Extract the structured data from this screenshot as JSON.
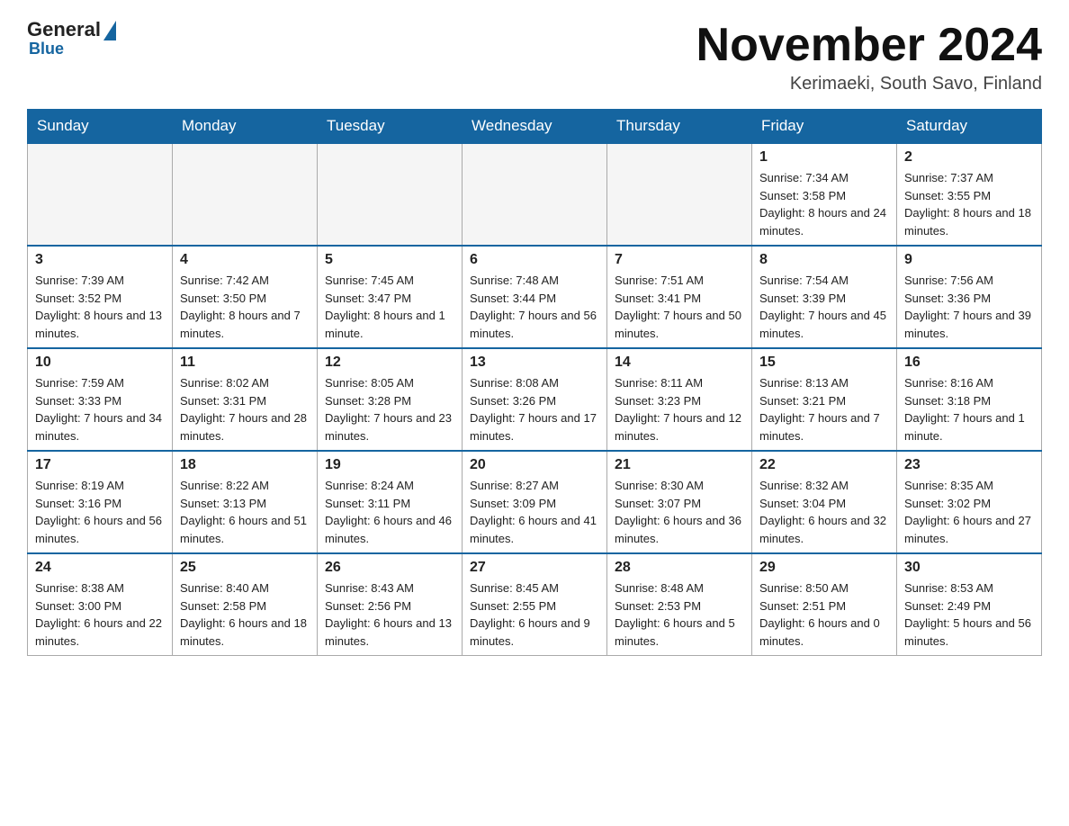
{
  "header": {
    "logo_general": "General",
    "logo_blue": "Blue",
    "month_title": "November 2024",
    "location": "Kerimaeki, South Savo, Finland"
  },
  "days_of_week": [
    "Sunday",
    "Monday",
    "Tuesday",
    "Wednesday",
    "Thursday",
    "Friday",
    "Saturday"
  ],
  "weeks": [
    [
      {
        "day": "",
        "info": ""
      },
      {
        "day": "",
        "info": ""
      },
      {
        "day": "",
        "info": ""
      },
      {
        "day": "",
        "info": ""
      },
      {
        "day": "",
        "info": ""
      },
      {
        "day": "1",
        "info": "Sunrise: 7:34 AM\nSunset: 3:58 PM\nDaylight: 8 hours and 24 minutes."
      },
      {
        "day": "2",
        "info": "Sunrise: 7:37 AM\nSunset: 3:55 PM\nDaylight: 8 hours and 18 minutes."
      }
    ],
    [
      {
        "day": "3",
        "info": "Sunrise: 7:39 AM\nSunset: 3:52 PM\nDaylight: 8 hours and 13 minutes."
      },
      {
        "day": "4",
        "info": "Sunrise: 7:42 AM\nSunset: 3:50 PM\nDaylight: 8 hours and 7 minutes."
      },
      {
        "day": "5",
        "info": "Sunrise: 7:45 AM\nSunset: 3:47 PM\nDaylight: 8 hours and 1 minute."
      },
      {
        "day": "6",
        "info": "Sunrise: 7:48 AM\nSunset: 3:44 PM\nDaylight: 7 hours and 56 minutes."
      },
      {
        "day": "7",
        "info": "Sunrise: 7:51 AM\nSunset: 3:41 PM\nDaylight: 7 hours and 50 minutes."
      },
      {
        "day": "8",
        "info": "Sunrise: 7:54 AM\nSunset: 3:39 PM\nDaylight: 7 hours and 45 minutes."
      },
      {
        "day": "9",
        "info": "Sunrise: 7:56 AM\nSunset: 3:36 PM\nDaylight: 7 hours and 39 minutes."
      }
    ],
    [
      {
        "day": "10",
        "info": "Sunrise: 7:59 AM\nSunset: 3:33 PM\nDaylight: 7 hours and 34 minutes."
      },
      {
        "day": "11",
        "info": "Sunrise: 8:02 AM\nSunset: 3:31 PM\nDaylight: 7 hours and 28 minutes."
      },
      {
        "day": "12",
        "info": "Sunrise: 8:05 AM\nSunset: 3:28 PM\nDaylight: 7 hours and 23 minutes."
      },
      {
        "day": "13",
        "info": "Sunrise: 8:08 AM\nSunset: 3:26 PM\nDaylight: 7 hours and 17 minutes."
      },
      {
        "day": "14",
        "info": "Sunrise: 8:11 AM\nSunset: 3:23 PM\nDaylight: 7 hours and 12 minutes."
      },
      {
        "day": "15",
        "info": "Sunrise: 8:13 AM\nSunset: 3:21 PM\nDaylight: 7 hours and 7 minutes."
      },
      {
        "day": "16",
        "info": "Sunrise: 8:16 AM\nSunset: 3:18 PM\nDaylight: 7 hours and 1 minute."
      }
    ],
    [
      {
        "day": "17",
        "info": "Sunrise: 8:19 AM\nSunset: 3:16 PM\nDaylight: 6 hours and 56 minutes."
      },
      {
        "day": "18",
        "info": "Sunrise: 8:22 AM\nSunset: 3:13 PM\nDaylight: 6 hours and 51 minutes."
      },
      {
        "day": "19",
        "info": "Sunrise: 8:24 AM\nSunset: 3:11 PM\nDaylight: 6 hours and 46 minutes."
      },
      {
        "day": "20",
        "info": "Sunrise: 8:27 AM\nSunset: 3:09 PM\nDaylight: 6 hours and 41 minutes."
      },
      {
        "day": "21",
        "info": "Sunrise: 8:30 AM\nSunset: 3:07 PM\nDaylight: 6 hours and 36 minutes."
      },
      {
        "day": "22",
        "info": "Sunrise: 8:32 AM\nSunset: 3:04 PM\nDaylight: 6 hours and 32 minutes."
      },
      {
        "day": "23",
        "info": "Sunrise: 8:35 AM\nSunset: 3:02 PM\nDaylight: 6 hours and 27 minutes."
      }
    ],
    [
      {
        "day": "24",
        "info": "Sunrise: 8:38 AM\nSunset: 3:00 PM\nDaylight: 6 hours and 22 minutes."
      },
      {
        "day": "25",
        "info": "Sunrise: 8:40 AM\nSunset: 2:58 PM\nDaylight: 6 hours and 18 minutes."
      },
      {
        "day": "26",
        "info": "Sunrise: 8:43 AM\nSunset: 2:56 PM\nDaylight: 6 hours and 13 minutes."
      },
      {
        "day": "27",
        "info": "Sunrise: 8:45 AM\nSunset: 2:55 PM\nDaylight: 6 hours and 9 minutes."
      },
      {
        "day": "28",
        "info": "Sunrise: 8:48 AM\nSunset: 2:53 PM\nDaylight: 6 hours and 5 minutes."
      },
      {
        "day": "29",
        "info": "Sunrise: 8:50 AM\nSunset: 2:51 PM\nDaylight: 6 hours and 0 minutes."
      },
      {
        "day": "30",
        "info": "Sunrise: 8:53 AM\nSunset: 2:49 PM\nDaylight: 5 hours and 56 minutes."
      }
    ]
  ]
}
